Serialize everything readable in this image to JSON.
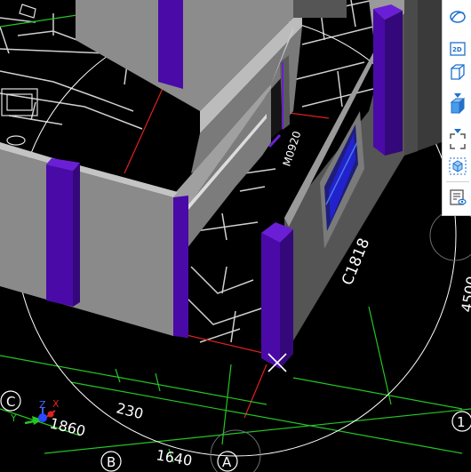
{
  "scene": {
    "door_tag": "M0920",
    "window_tag": "C1818",
    "dimensions": {
      "d1": "230",
      "d2": "1860",
      "d3": "1640",
      "d4": "4500"
    },
    "axis_bubbles": {
      "c": "C",
      "b": "B",
      "a": "A",
      "one": "1"
    },
    "gizmo": {
      "x": "X",
      "y": "Y",
      "z": "Z"
    }
  },
  "toolbar": {
    "buttons": [
      {
        "icon": "orbit-icon"
      },
      {
        "icon": "view-2d-icon",
        "label": "2D"
      },
      {
        "icon": "wireframe-cube-icon"
      },
      {
        "icon": "shaded-cube-icon"
      },
      {
        "icon": "fullscreen-icon"
      },
      {
        "icon": "isolate-cube-icon"
      },
      {
        "icon": "properties-view-icon"
      }
    ]
  },
  "colors": {
    "background": "#000000",
    "wall_front": "#8a8a8a",
    "wall_side": "#6b6b6b",
    "column": "#4a0aa8",
    "column_top": "#6a1fd6",
    "axis_red": "#e02020",
    "axis_green": "#25c425",
    "floor_grid": "#d8d8d8",
    "toolbar_icon": "#1e6fd0"
  }
}
